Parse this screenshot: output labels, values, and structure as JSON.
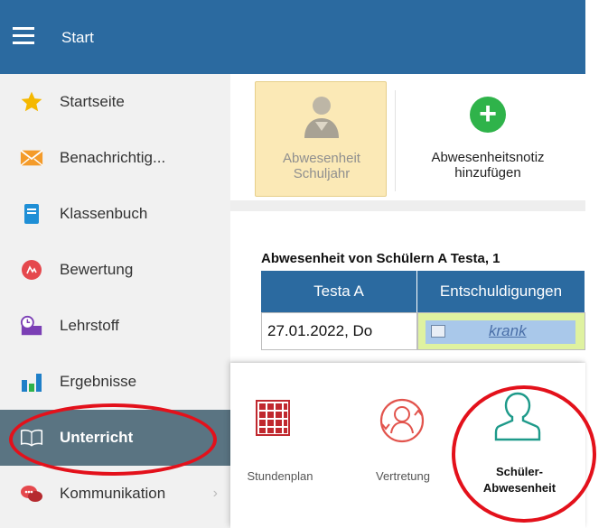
{
  "topbar": {
    "menu_icon": "hamburger-menu-icon",
    "title": "Start"
  },
  "sidebar": {
    "items": [
      {
        "label": "Startseite",
        "icon": "star-icon"
      },
      {
        "label": "Benachrichtig...",
        "icon": "envelope-icon"
      },
      {
        "label": "Klassenbuch",
        "icon": "book-icon"
      },
      {
        "label": "Bewertung",
        "icon": "grade-icon"
      },
      {
        "label": "Lehrstoff",
        "icon": "lesson-material-icon"
      },
      {
        "label": "Ergebnisse",
        "icon": "bar-chart-icon"
      },
      {
        "label": "Unterricht",
        "icon": "open-book-icon",
        "active": true
      },
      {
        "label": "Kommunikation",
        "icon": "chat-icon"
      }
    ]
  },
  "toolbar": {
    "absence_year_label_line1": "Abwesenheit",
    "absence_year_label_line2": "Schuljahr",
    "add_note_label_line1": "Abwesenheitsnotiz",
    "add_note_label_line2": "hinzufügen"
  },
  "content": {
    "title": "Abwesenheit von Schülern A Testa, 1",
    "table": {
      "headers": [
        "Testa A",
        "Entschuldigungen"
      ],
      "rows": [
        {
          "date": "27.01.2022, Do",
          "excuse": "krank"
        }
      ]
    }
  },
  "flyout": {
    "items": [
      {
        "label": "Stundenplan",
        "icon": "timetable-icon"
      },
      {
        "label": "Vertretung",
        "icon": "substitution-icon"
      },
      {
        "label_line1": "Schüler-",
        "label_line2": "Abwesenheit",
        "icon": "student-absence-icon"
      }
    ]
  },
  "colors": {
    "topbar": "#2b6aa0",
    "sidebar_active": "#5a7482",
    "annotation": "#e3111b",
    "add_green": "#2fb34a",
    "timetable_red": "#c0282e",
    "student_teal": "#1e9a8a"
  }
}
